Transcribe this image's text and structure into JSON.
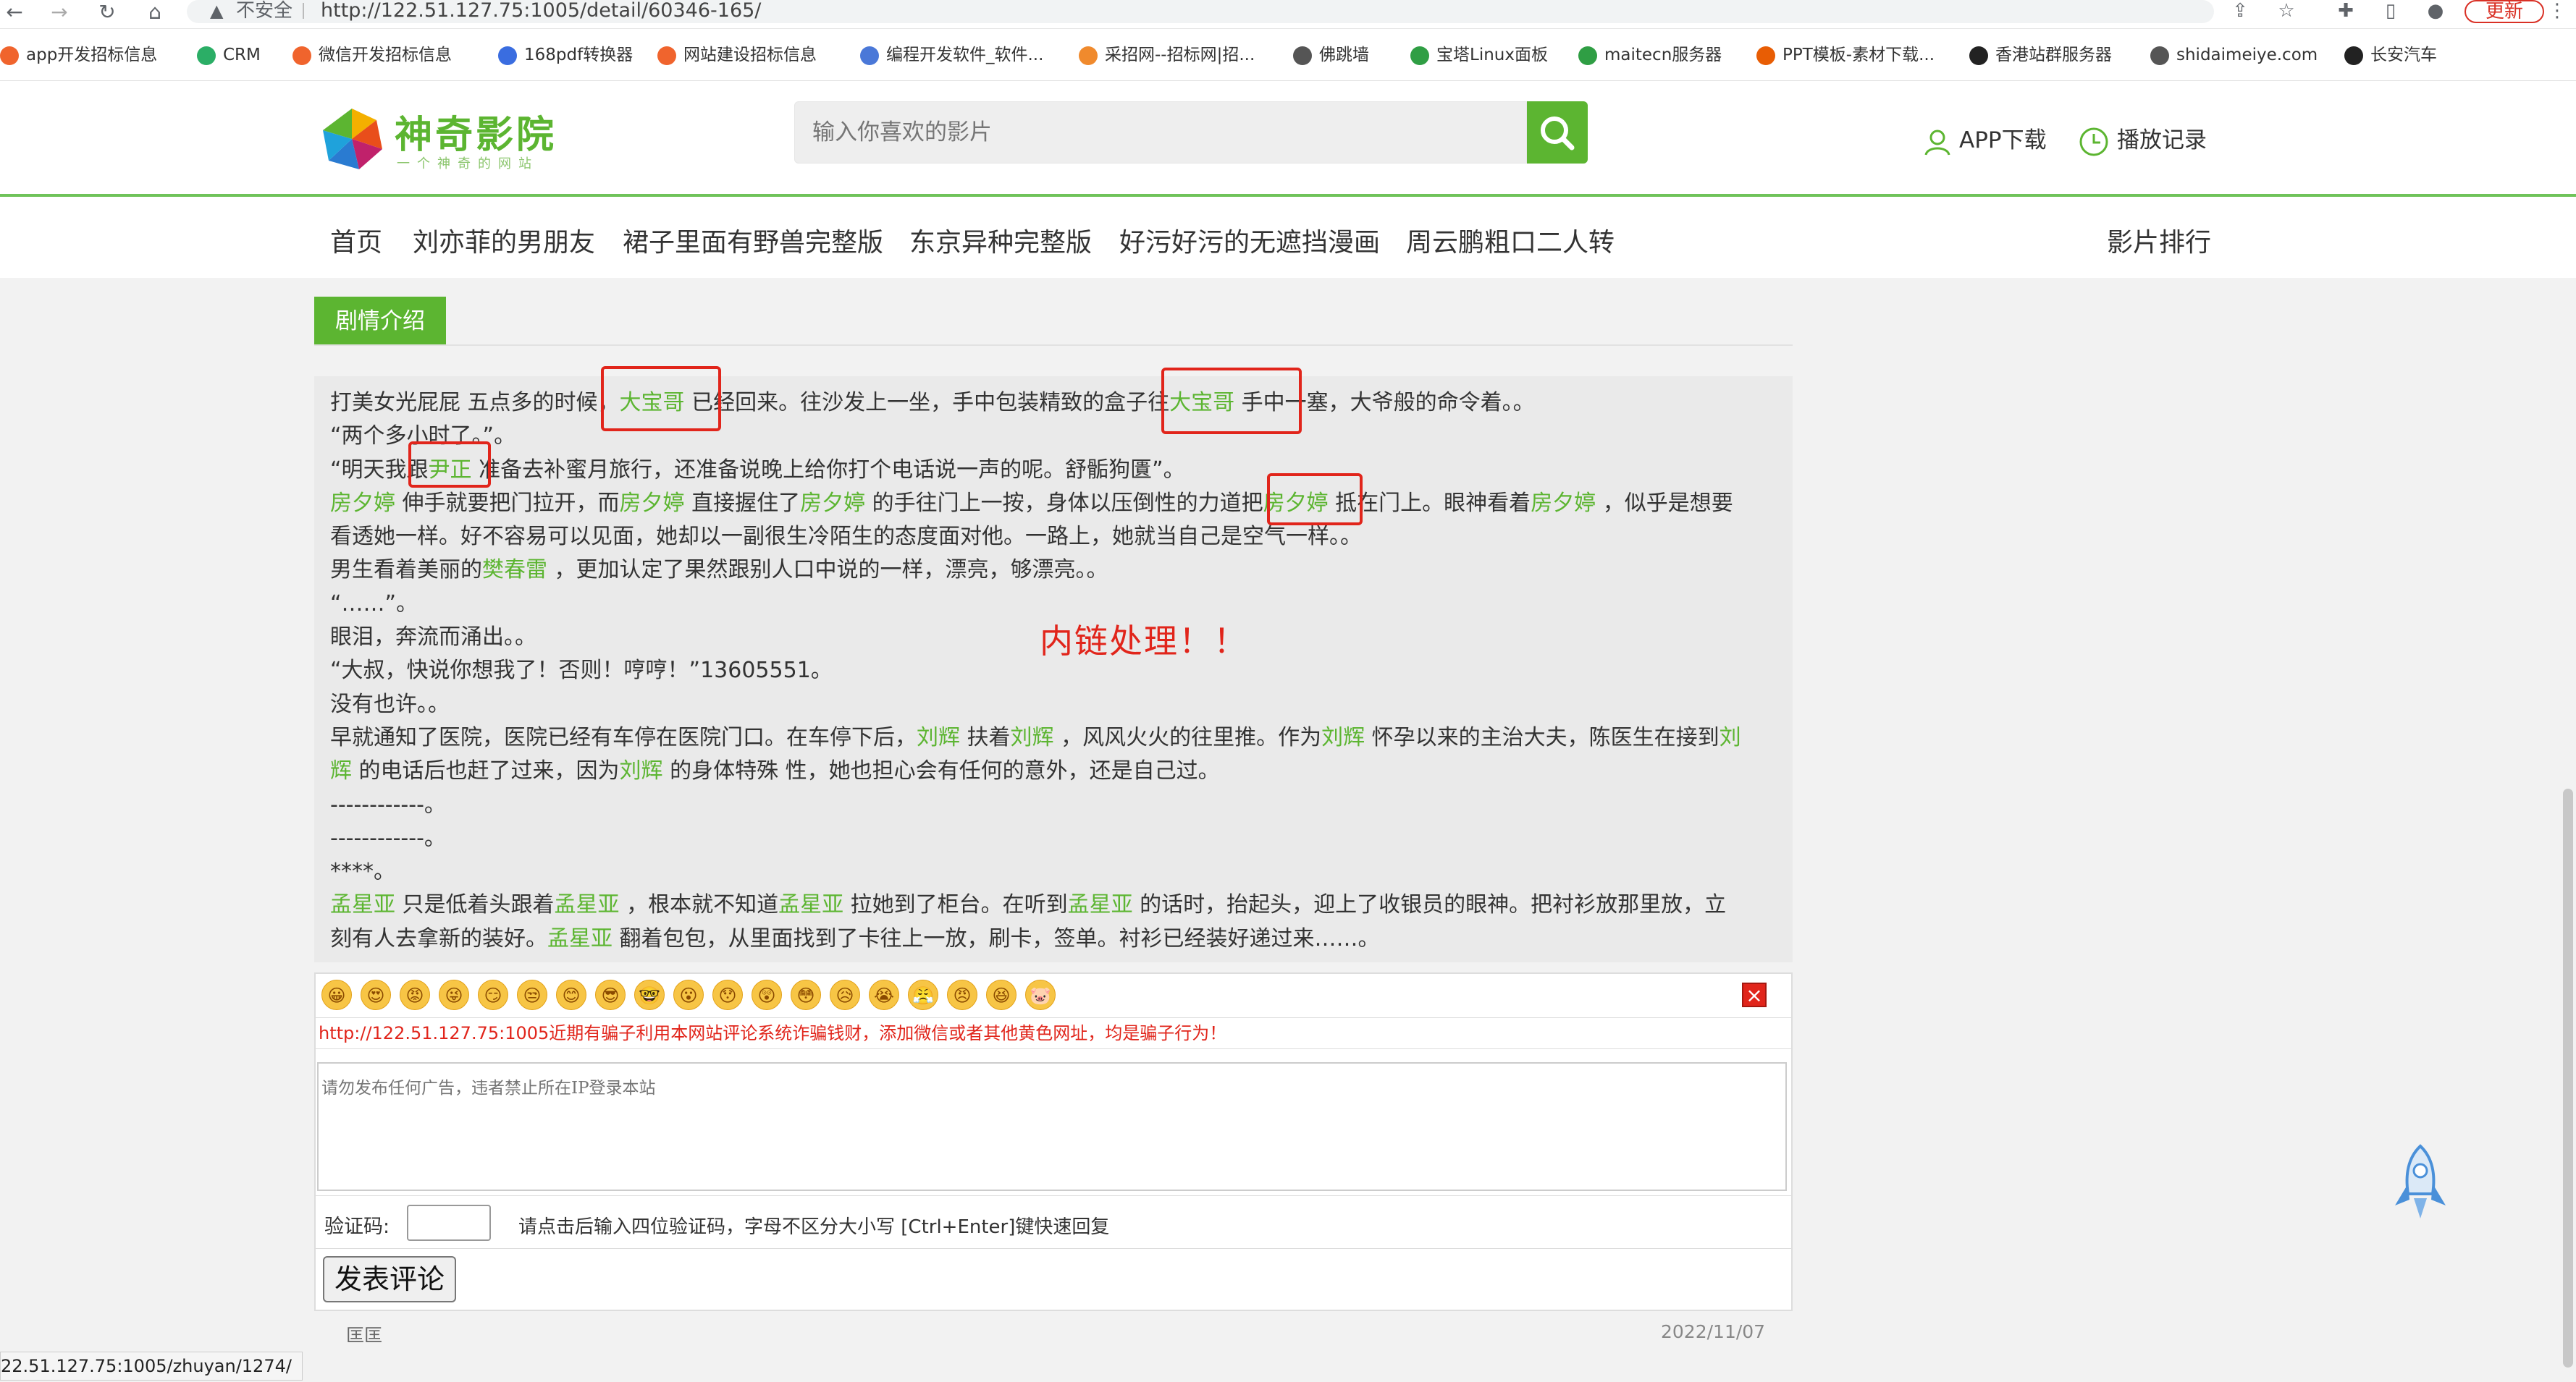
{
  "browser": {
    "insecure_label": "不安全",
    "url": "http://122.51.127.75:1005/detail/60346-165/",
    "update_label": "更新"
  },
  "bookmarks": [
    {
      "label": "app开发招标信息",
      "color": "#f0642d"
    },
    {
      "label": "CRM",
      "color": "#2bae66"
    },
    {
      "label": "微信开发招标信息",
      "color": "#f0642d"
    },
    {
      "label": "168pdf转换器",
      "color": "#3a6de0"
    },
    {
      "label": "网站建设招标信息",
      "color": "#f0642d"
    },
    {
      "label": "编程开发软件_软件...",
      "color": "#4a78d8"
    },
    {
      "label": "采招网--招标网|招...",
      "color": "#f08a2d"
    },
    {
      "label": "佛跳墙",
      "color": "#555555"
    },
    {
      "label": "宝塔Linux面板",
      "color": "#2f9e44"
    },
    {
      "label": "maitecn服务器",
      "color": "#2f9e44"
    },
    {
      "label": "PPT模板-素材下载...",
      "color": "#e85d04"
    },
    {
      "label": "香港站群服务器",
      "color": "#222222"
    },
    {
      "label": "shidaimeiye.com",
      "color": "#555555"
    },
    {
      "label": "长安汽车",
      "color": "#222222"
    }
  ],
  "site": {
    "logo_title": "神奇影院",
    "logo_sub": "一个神奇的网站",
    "search_placeholder": "输入你喜欢的影片",
    "app_download": "APP下载",
    "play_history": "播放记录",
    "accent": "#5cb531"
  },
  "nav": {
    "items": [
      "首页",
      "刘亦菲的男朋友",
      "裙子里面有野兽完整版",
      "东京异种完整版",
      "好污好污的无遮挡漫画",
      "周云鹏粗口二人转"
    ],
    "ranking": "影片排行"
  },
  "story": {
    "tab_label": "剧情介绍",
    "annotation": "内链处理！！",
    "lines": {
      "l1a": "打美女光屁屁 五点多的时候，",
      "l1b": "大宝哥",
      "l1c": " 已经回来。往沙发上一坐，手中包装精致的盒子往",
      "l1d": "大宝哥",
      "l1e": " 手中一塞，大爷般的命令着。。",
      "l2": "“两个多小时了。”。",
      "l3a": "“明天我跟",
      "l3b": "尹正",
      "l3c": " 准备去补蜜月旅行，还准备说晚上给你打个电话说一声的呢。舒骺狗匱”。",
      "l4a": "房夕婷",
      "l4b": " 伸手就要把门拉开，而",
      "l4c": "房夕婷",
      "l4d": " 直接握住了",
      "l4e": "房夕婷",
      "l4f": " 的手往门上一按，身体以压倒性的力道把",
      "l4g": "房夕婷",
      "l4h": " 抵在门上。眼神看着",
      "l4i": "房夕婷",
      "l4j": " ，似乎是想要",
      "l5": "看透她一样。好不容易可以见面，她却以一副很生冷陌生的态度面对他。一路上，她就当自己是空气一样。。",
      "l6a": "男生看着美丽的",
      "l6b": "樊春雷",
      "l6c": " ，更加认定了果然跟别人口中说的一样，漂亮，够漂亮。。",
      "l7": "“……”。",
      "l8": "眼泪，奔流而涌出。。",
      "l9": "“大叔，快说你想我了！否则！哼哼！”13605551。",
      "l10": "没有也许。。",
      "l11a": "早就通知了医院，医院已经有车停在医院门口。在车停下后，",
      "l11b": "刘辉",
      "l11c": " 扶着",
      "l11d": "刘辉",
      "l11e": " ，风风火火的往里推。作为",
      "l11f": "刘辉",
      "l11g": " 怀孕以来的主治大夫，陈医生在接到",
      "l11h": "刘",
      "l12a": "辉",
      "l12b": " 的电话后也赶了过来，因为",
      "l12c": "刘辉",
      "l12d": " 的身体特殊 性，她也担心会有任何的意外，还是自己过。",
      "l13": "------------。",
      "l14": "------------。",
      "l15": "****。",
      "l16a": "孟星亚",
      "l16b": " 只是低着头跟着",
      "l16c": "孟星亚",
      "l16d": " ，根本就不知道",
      "l16e": "孟星亚",
      "l16f": " 拉她到了柜台。在听到",
      "l16g": "孟星亚",
      "l16h": " 的话时，抬起头，迎上了收银员的眼神。把衬衫放那里放，立",
      "l17a": "刻有人去拿新的装好。",
      "l17b": "孟星亚",
      "l17c": " 翻着包包，从里面找到了卡往上一放，刷卡，签单。衬衫已经装好递过来……。"
    }
  },
  "comment": {
    "emojis": [
      "😀",
      "😍",
      "😡",
      "😜",
      "😏",
      "😒",
      "😊",
      "😎",
      "🤓",
      "😮",
      "😯",
      "😲",
      "😳",
      "😥",
      "😭",
      "😤",
      "😠",
      "😆",
      "🐷"
    ],
    "warning": "http://122.51.127.75:1005近期有骗子利用本网站评论系统诈骗钱财，添加微信或者其他黄色网址，均是骗子行为！",
    "placeholder": "请勿发布任何广告，违者禁止所在IP登录本站",
    "captcha_label": "验证码:",
    "captcha_hint": "请点击后输入四位验证码，字母不区分大小写 [Ctrl+Enter]键快速回复",
    "submit_label": "发表评论"
  },
  "footer": {
    "left": "匡匡",
    "date": "2022/11/07"
  },
  "status_bar_url": "22.51.127.75:1005/zhuyan/1274/"
}
